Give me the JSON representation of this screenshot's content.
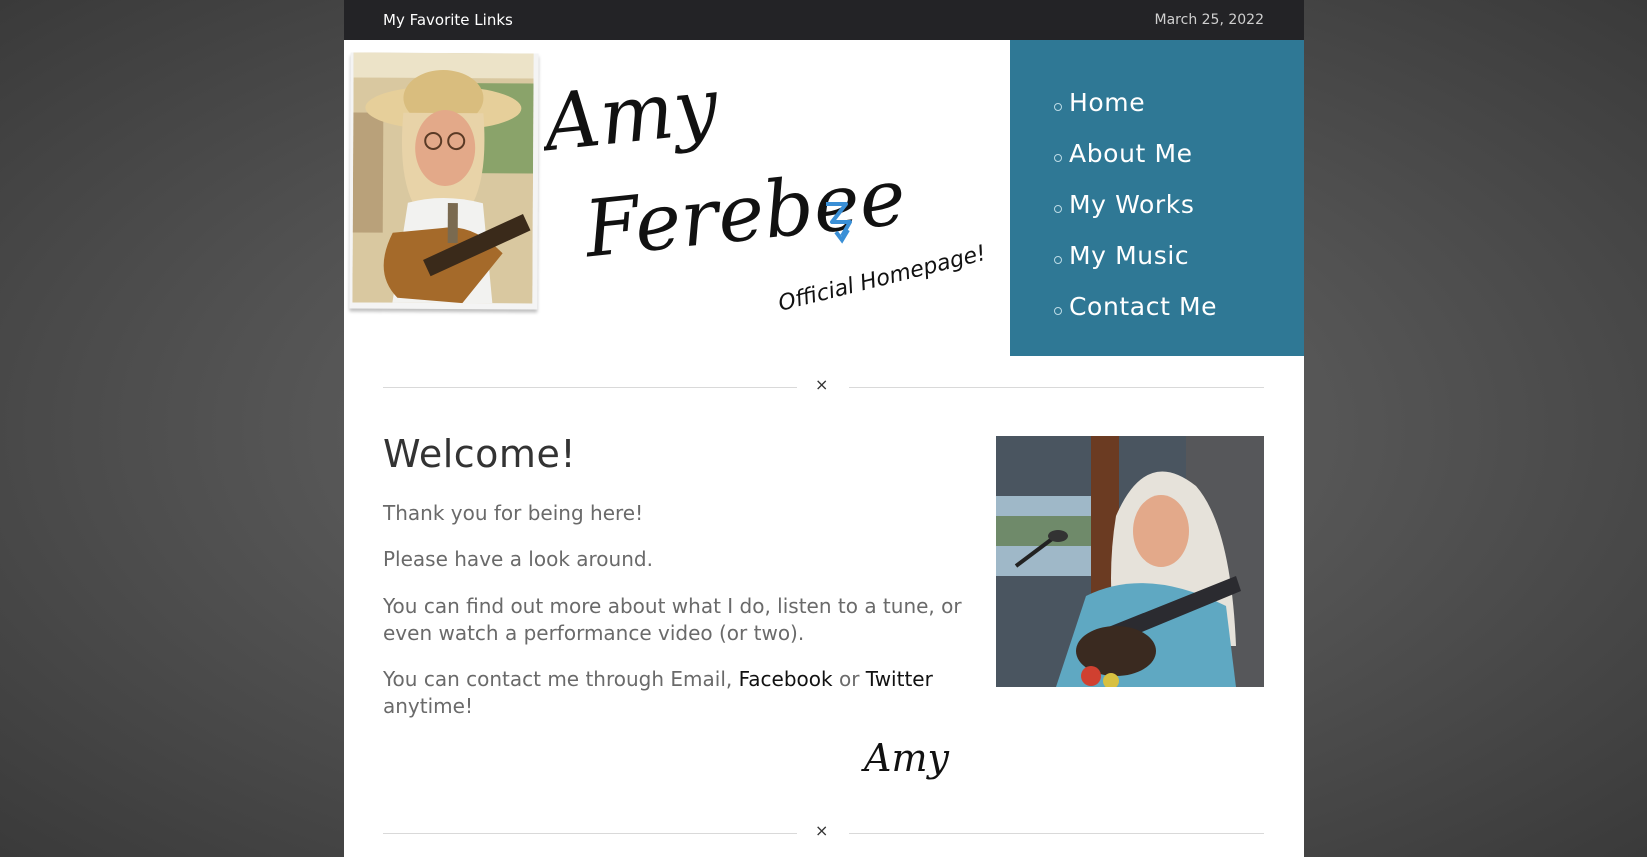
{
  "topbar": {
    "links_label": "My Favorite Links",
    "date": "March 25, 2022"
  },
  "header": {
    "logo_line1": "Amy",
    "logo_line2": "Ferebee",
    "logo_tagline": "Official Homepage!"
  },
  "nav": {
    "items": [
      {
        "label": "Home"
      },
      {
        "label": "About Me"
      },
      {
        "label": "My Works"
      },
      {
        "label": "My Music"
      },
      {
        "label": "Contact Me"
      }
    ]
  },
  "divider_glyph": "×",
  "welcome": {
    "title": "Welcome!",
    "p1": "Thank you for being here!",
    "p2": "Please have a look around.",
    "p3": "You can find out more about what I do, listen to a tune, or even watch a performance video (or two).",
    "p4_before": "You can contact me through Email, ",
    "p4_link1": "Facebook",
    "p4_mid": " or ",
    "p4_link2": "Twitter",
    "p4_after": " anytime!",
    "signature": "Amy"
  },
  "colors": {
    "nav_bg": "#2f7895",
    "topbar_bg": "#232326",
    "page_bg": "#ffffff",
    "arrow_accent": "#3a8fd6"
  }
}
